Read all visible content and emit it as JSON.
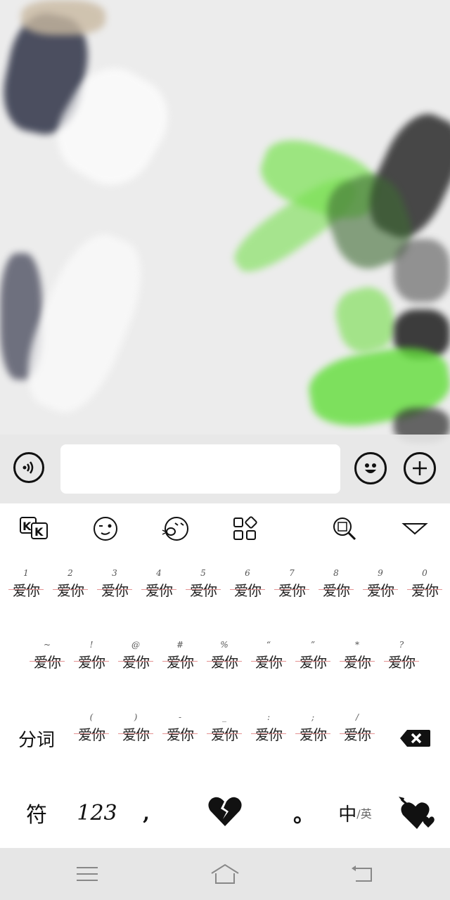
{
  "input_bar": {
    "message_value": "",
    "voice_icon": "voice-wave-icon",
    "emoji_icon": "smiley-icon",
    "plus_icon": "plus-icon"
  },
  "keyboard_toolbar": {
    "items": [
      "kk-logo-icon",
      "wink-face-icon",
      "shout-face-icon",
      "apps-grid-icon",
      "image-search-icon",
      "collapse-triangle-icon"
    ]
  },
  "row1": {
    "keys": [
      {
        "hint": "1",
        "label": "爱你"
      },
      {
        "hint": "2",
        "label": "爱你"
      },
      {
        "hint": "3",
        "label": "爱你"
      },
      {
        "hint": "4",
        "label": "爱你"
      },
      {
        "hint": "5",
        "label": "爱你"
      },
      {
        "hint": "6",
        "label": "爱你"
      },
      {
        "hint": "7",
        "label": "爱你"
      },
      {
        "hint": "8",
        "label": "爱你"
      },
      {
        "hint": "9",
        "label": "爱你"
      },
      {
        "hint": "0",
        "label": "爱你"
      }
    ]
  },
  "row2": {
    "keys": [
      {
        "hint": "~",
        "label": "爱你"
      },
      {
        "hint": "!",
        "label": "爱你"
      },
      {
        "hint": "@",
        "label": "爱你"
      },
      {
        "hint": "#",
        "label": "爱你"
      },
      {
        "hint": "%",
        "label": "爱你"
      },
      {
        "hint": "“",
        "label": "爱你"
      },
      {
        "hint": "”",
        "label": "爱你"
      },
      {
        "hint": "*",
        "label": "爱你"
      },
      {
        "hint": "?",
        "label": "爱你"
      }
    ]
  },
  "row3": {
    "left_label": "分词",
    "keys": [
      {
        "hint": "(",
        "label": "爱你"
      },
      {
        "hint": ")",
        "label": "爱你"
      },
      {
        "hint": "-",
        "label": "爱你"
      },
      {
        "hint": "_",
        "label": "爱你"
      },
      {
        "hint": ":",
        "label": "爱你"
      },
      {
        "hint": ";",
        "label": "爱你"
      },
      {
        "hint": "/",
        "label": "爱你"
      }
    ],
    "delete_icon": "backspace-icon"
  },
  "row4": {
    "symbol_label": "符",
    "number_label": "123",
    "comma_label": ",",
    "space_icon": "broken-heart-icon",
    "period_label": "。",
    "lang_main": "中",
    "lang_sub": "/英",
    "enter_icon": "arrow-hearts-icon"
  },
  "navbar": {
    "items": [
      "menu-icon",
      "home-icon",
      "back-icon"
    ]
  },
  "colors": {
    "accent_green": "#6fe04a",
    "stroke_dark": "#2a2f45",
    "delete_key": "#111111"
  }
}
